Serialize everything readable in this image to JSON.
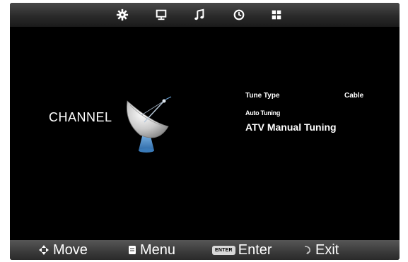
{
  "top_tabs": [
    {
      "icon": "gear-icon"
    },
    {
      "icon": "monitor-icon"
    },
    {
      "icon": "music-note-icon"
    },
    {
      "icon": "clock-icon"
    },
    {
      "icon": "grid-icon"
    }
  ],
  "page": {
    "title": "CHANNEL"
  },
  "menu": {
    "tune_type_label": "Tune Type",
    "tune_type_value": "Cable",
    "auto_tuning": "Auto Tuning",
    "atv_manual_tuning": "ATV Manual Tuning"
  },
  "footer": {
    "move_label": "Move",
    "menu_label": "Menu",
    "enter_key_label": "ENTER",
    "enter_label": "Enter",
    "exit_label": "Exit"
  },
  "colors": {
    "background": "#000000",
    "text": "#ffffff",
    "dish_accent": "#4a8fc8"
  }
}
